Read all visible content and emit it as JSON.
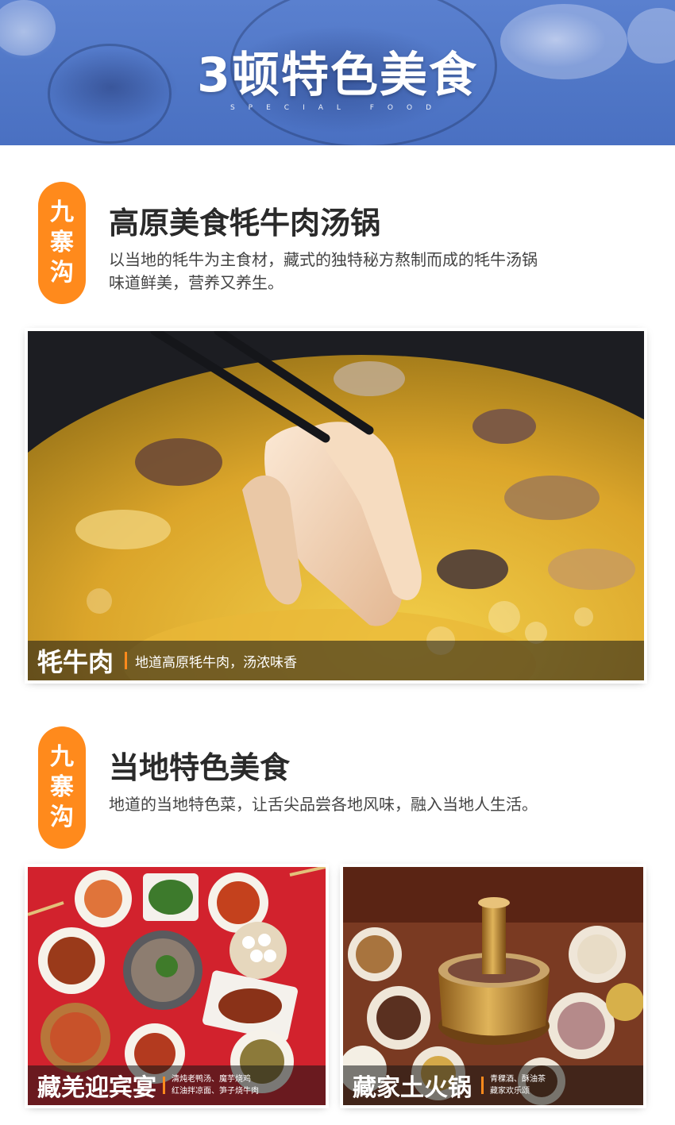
{
  "header": {
    "title": "3顿特色美食",
    "subtitle": "SPECIAL FOOD"
  },
  "sections": [
    {
      "tag_chars": [
        "九",
        "寨",
        "沟"
      ],
      "title": "高原美食牦牛肉汤锅",
      "desc_lines": [
        "以当地的牦牛为主食材，藏式的独特秘方熬制而成的牦牛汤锅",
        "味道鲜美，营养又养生。"
      ],
      "photo": {
        "name": "牦牛肉",
        "note": "地道高原牦牛肉，汤浓味香"
      }
    },
    {
      "tag_chars": [
        "九",
        "寨",
        "沟"
      ],
      "title": "当地特色美食",
      "desc_lines": [
        "地道的当地特色菜，让舌尖品尝各地风味，融入当地人生活。"
      ],
      "photos": [
        {
          "name": "藏羌迎宾宴",
          "note_lines": [
            "清炖老鸭汤、魔芋烧鸡",
            "红油拌凉面、笋子烧牛肉"
          ]
        },
        {
          "name": "藏家土火锅",
          "note_lines": [
            "青稞酒、酥油茶",
            "藏家欢乐颂"
          ]
        }
      ]
    }
  ],
  "colors": {
    "accent": "#ff8a1c",
    "banner_blue": "#4f76c6",
    "title_text": "#2a2a2a"
  }
}
